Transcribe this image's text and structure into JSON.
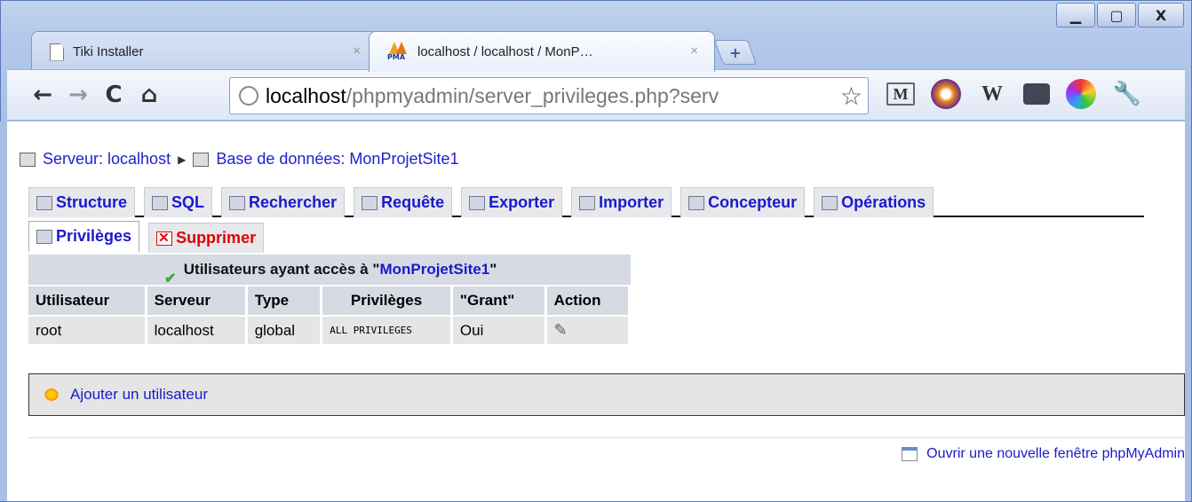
{
  "window": {
    "controls": {
      "minimize": "▁",
      "maximize": "▢",
      "close": "X"
    }
  },
  "tabs": [
    {
      "title": "Tiki Installer",
      "close": "×",
      "icon": "page-icon"
    },
    {
      "title": "localhost / localhost / MonP…",
      "close": "×",
      "icon": "phpmyadmin-icon"
    }
  ],
  "newtab_label": "+",
  "toolbar": {
    "back": "←",
    "forward": "→",
    "reload": "C",
    "home": "⌂",
    "url_host": "localhost",
    "url_path": "/phpmyadmin/server_privileges.php?serv",
    "star": "☆",
    "extensions": {
      "gmail": "M",
      "w": "W",
      "wrench": "🔧"
    }
  },
  "breadcrumb": {
    "server": "Serveur: localhost",
    "sep": "▶",
    "database": "Base de données: MonProjetSite1"
  },
  "pma_tabs": [
    "Structure",
    "SQL",
    "Rechercher",
    "Requête",
    "Exporter",
    "Importer",
    "Concepteur",
    "Opérations"
  ],
  "pma_tabs2": {
    "privileges": "Privilèges",
    "drop": "Supprimer"
  },
  "users": {
    "caption_prefix": "Utilisateurs ayant accès à \"",
    "caption_db": "MonProjetSite1",
    "caption_suffix": "\"",
    "headers": [
      "Utilisateur",
      "Serveur",
      "Type",
      "Privilèges",
      "\"Grant\"",
      "Action"
    ],
    "rows": [
      [
        "root",
        "localhost",
        "global",
        "ALL PRIVILEGES",
        "Oui"
      ]
    ]
  },
  "add_user": "Ajouter un utilisateur",
  "new_window": "Ouvrir une nouvelle fenêtre phpMyAdmin"
}
